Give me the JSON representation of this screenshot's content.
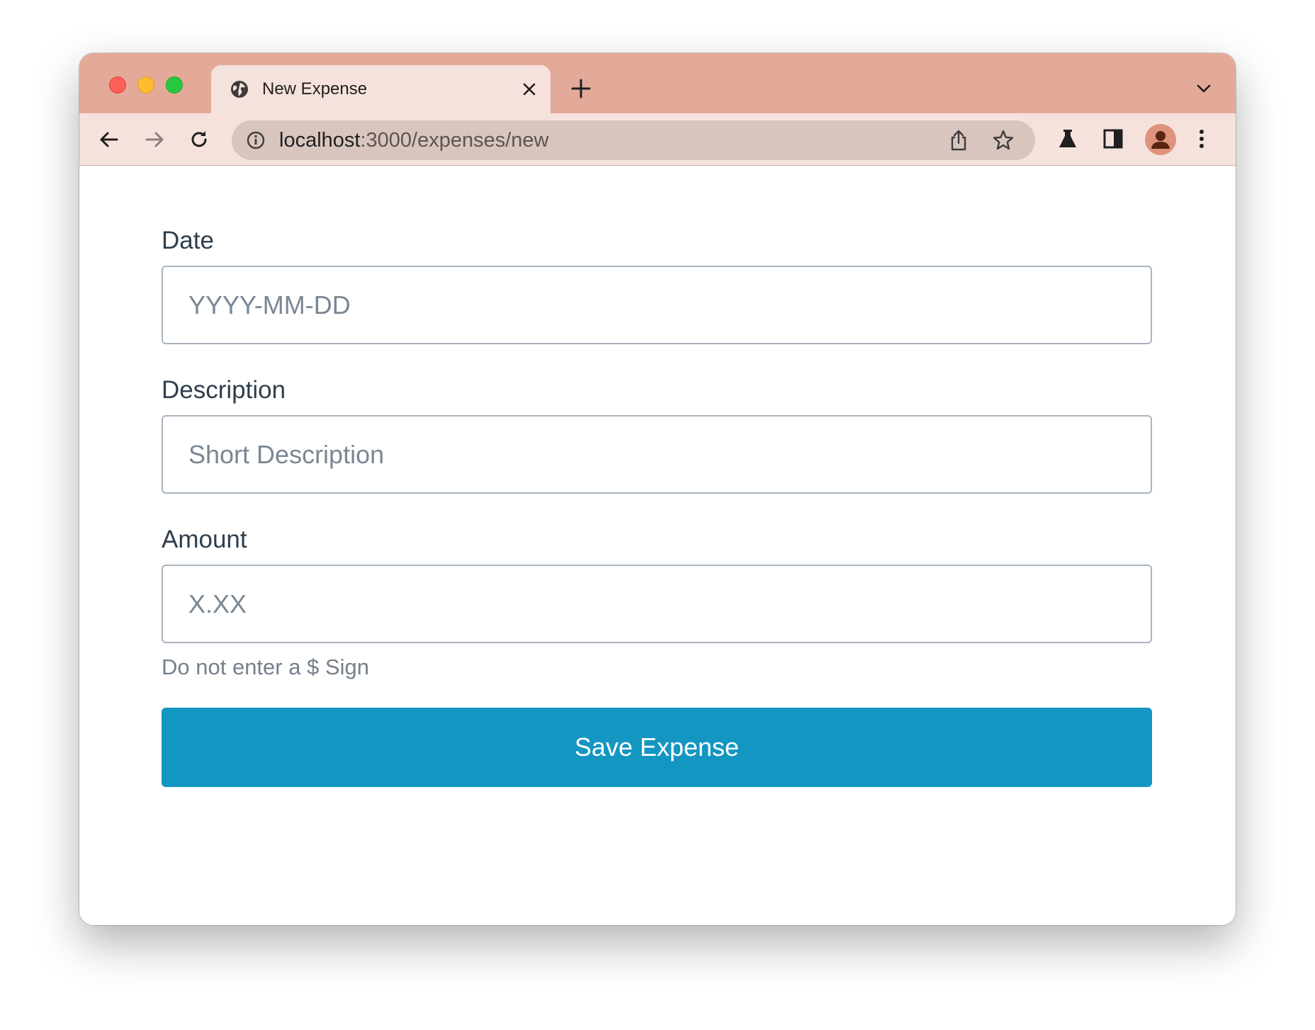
{
  "browser": {
    "tab_title": "New Expense",
    "url_host": "localhost",
    "url_path": ":3000/expenses/new",
    "accent_colors": {
      "titlebar": "#e3aa99",
      "toolbar": "#f6e2dc",
      "omnibox": "#d8c6be"
    },
    "icons": {
      "tab_favicon": "globe-icon",
      "tab_close": "close-icon",
      "new_tab": "plus-icon",
      "tab_search": "chevron-down-icon",
      "back": "arrow-left-icon",
      "forward": "arrow-right-icon",
      "reload": "reload-icon",
      "site_info": "info-icon",
      "share": "share-icon",
      "bookmark": "star-icon",
      "labs": "flask-icon",
      "side_panel": "side-panel-icon",
      "profile": "avatar-icon",
      "menu": "kebab-menu-icon"
    }
  },
  "form": {
    "date": {
      "label": "Date",
      "placeholder": "YYYY-MM-DD",
      "value": ""
    },
    "description": {
      "label": "Description",
      "placeholder": "Short Description",
      "value": ""
    },
    "amount": {
      "label": "Amount",
      "placeholder": "X.XX",
      "value": "",
      "help_text": "Do not enter a $ Sign"
    },
    "submit_label": "Save Expense",
    "submit_color": "#1396c2"
  }
}
